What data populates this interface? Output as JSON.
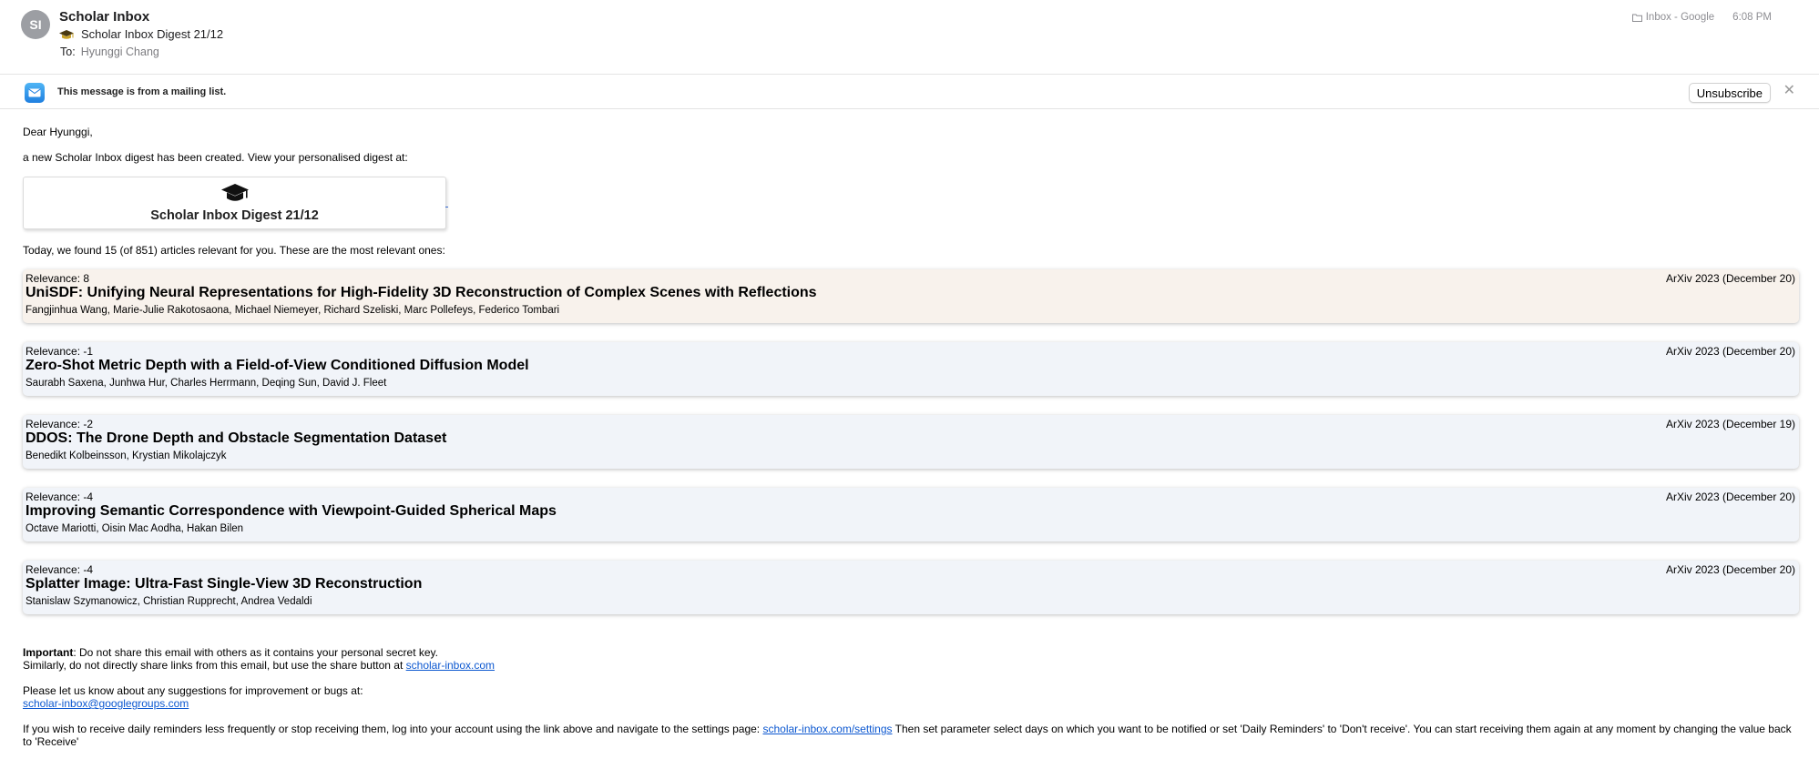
{
  "header": {
    "avatar_initials": "SI",
    "sender": "Scholar Inbox",
    "subject": "Scholar Inbox Digest 21/12",
    "to_label": "To:",
    "to_value": "Hyunggi Chang",
    "mailbox": "Inbox - Google",
    "time": "6:08 PM"
  },
  "mailing_list": {
    "notice": "This message is from a mailing list.",
    "unsubscribe_label": "Unsubscribe",
    "close_label": "✕"
  },
  "body": {
    "greeting": "Dear Hyunggi,",
    "intro": "a new Scholar Inbox digest has been created. View your personalised digest at:",
    "digest_button_label": "Scholar Inbox Digest 21/12",
    "found": "Today, we found 15 (of 851) articles relevant for you. These are the most relevant ones:"
  },
  "articles": [
    {
      "relevance": "Relevance: 8",
      "date": "ArXiv 2023 (December 20)",
      "title": "UniSDF: Unifying Neural Representations for High-Fidelity 3D Reconstruction of Complex Scenes with Reflections",
      "authors": "Fangjinhua Wang, Marie-Julie Rakotosaona, Michael Niemeyer, Richard Szeliski, Marc Pollefeys, Federico Tombari",
      "highlight": true
    },
    {
      "relevance": "Relevance: -1",
      "date": "ArXiv 2023 (December 20)",
      "title": "Zero-Shot Metric Depth with a Field-of-View Conditioned Diffusion Model",
      "authors": "Saurabh Saxena, Junhwa Hur, Charles Herrmann, Deqing Sun, David J. Fleet",
      "highlight": false
    },
    {
      "relevance": "Relevance: -2",
      "date": "ArXiv 2023 (December 19)",
      "title": "DDOS: The Drone Depth and Obstacle Segmentation Dataset",
      "authors": "Benedikt Kolbeinsson, Krystian Mikolajczyk",
      "highlight": false
    },
    {
      "relevance": "Relevance: -4",
      "date": "ArXiv 2023 (December 20)",
      "title": "Improving Semantic Correspondence with Viewpoint-Guided Spherical Maps",
      "authors": "Octave Mariotti, Oisin Mac Aodha, Hakan Bilen",
      "highlight": false
    },
    {
      "relevance": "Relevance: -4",
      "date": "ArXiv 2023 (December 20)",
      "title": "Splatter Image: Ultra-Fast Single-View 3D Reconstruction",
      "authors": "Stanislaw Szymanowicz, Christian Rupprecht, Andrea Vedaldi",
      "highlight": false
    }
  ],
  "footer": {
    "important_bold": "Important",
    "important_text": ": Do not share this email with others as it contains your personal secret key.",
    "share_text": "Similarly, do not directly share links from this email, but use the share button at ",
    "share_link": "scholar-inbox.com",
    "suggest_text": "Please let us know about any suggestions for improvement or bugs at:",
    "suggest_link": "scholar-inbox@googlegroups.com",
    "reminder_text_1": "If you wish to receive daily reminders less frequently or stop receiving them, log into your account using the link above and navigate to the settings page: ",
    "reminder_link": "scholar-inbox.com/settings",
    "reminder_text_2": " Then set parameter select days on which you want to be notified or set 'Daily Reminders' to 'Don't receive'. You can start receiving them again at any moment by changing the value back to 'Receive'"
  },
  "colors": {
    "highlight_card": "#f8f2ec",
    "card": "#f1f4f9",
    "link": "#0b57d0"
  },
  "icons": [
    "graduation-cap-icon",
    "folder-icon",
    "mail-icon",
    "close-icon"
  ]
}
